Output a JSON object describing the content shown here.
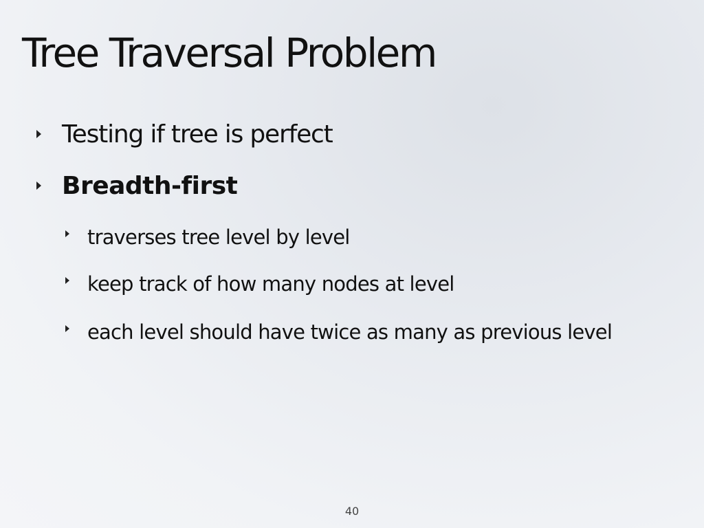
{
  "slide": {
    "title": "Tree Traversal Problem",
    "bullets": [
      {
        "text": "Testing if tree is perfect",
        "bold": false,
        "level": 1
      },
      {
        "text": "Breadth-first",
        "bold": true,
        "level": 1
      },
      {
        "text": "traverses tree level by level",
        "bold": false,
        "level": 2
      },
      {
        "text": "keep track of how many nodes at level",
        "bold": false,
        "level": 2
      },
      {
        "text": "each level should have twice as many as previous level",
        "bold": false,
        "level": 2
      }
    ],
    "page_number": "40"
  }
}
